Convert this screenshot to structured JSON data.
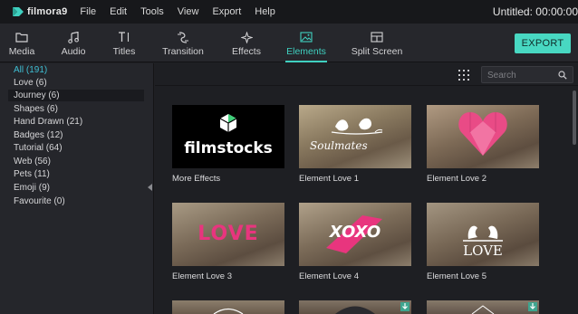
{
  "app": {
    "logo_text": "filmora9",
    "project_title": "Untitled: 00:00:00"
  },
  "menu": [
    "File",
    "Edit",
    "Tools",
    "View",
    "Export",
    "Help"
  ],
  "tabs": [
    {
      "label": "Media",
      "icon": "folder-icon"
    },
    {
      "label": "Audio",
      "icon": "music-note-icon"
    },
    {
      "label": "Titles",
      "icon": "text-icon"
    },
    {
      "label": "Transition",
      "icon": "transition-icon"
    },
    {
      "label": "Effects",
      "icon": "sparkle-icon"
    },
    {
      "label": "Elements",
      "icon": "image-icon",
      "active": true
    },
    {
      "label": "Split Screen",
      "icon": "split-screen-icon"
    }
  ],
  "export_label": "EXPORT",
  "categories": [
    {
      "label": "All (191)",
      "selected": true
    },
    {
      "label": "Love (6)"
    },
    {
      "label": "Journey (6)",
      "hover": true
    },
    {
      "label": "Shapes (6)"
    },
    {
      "label": "Hand Drawn (21)"
    },
    {
      "label": "Badges (12)"
    },
    {
      "label": "Tutorial (64)"
    },
    {
      "label": "Web (56)"
    },
    {
      "label": "Pets (11)"
    },
    {
      "label": "Emoji (9)"
    },
    {
      "label": "Favourite (0)"
    }
  ],
  "search": {
    "placeholder": "Search"
  },
  "items": [
    {
      "label": "More Effects",
      "thumb_text": "filmstocks"
    },
    {
      "label": "Element Love 1",
      "thumb_text": "Soulmates"
    },
    {
      "label": "Element Love 2",
      "thumb_text": ""
    },
    {
      "label": "Element Love 3",
      "thumb_text": "LOVE"
    },
    {
      "label": "Element Love 4",
      "thumb_text": "XOXO"
    },
    {
      "label": "Element Love 5",
      "thumb_text": "LOVE"
    }
  ],
  "colors": {
    "accent": "#3fd0c0",
    "export": "#48d8c2",
    "selected_category": "#3fbfd4"
  }
}
